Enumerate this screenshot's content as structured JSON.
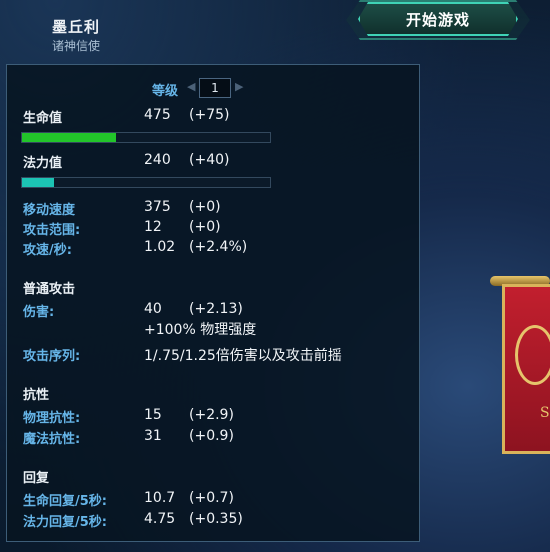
{
  "champion": {
    "name": "墨丘利",
    "title": "诸神信使"
  },
  "start_button": {
    "label": "开始游戏"
  },
  "level": {
    "label": "等级",
    "value": "1",
    "prev_icon": "triangle-left-icon",
    "next_icon": "triangle-right-icon"
  },
  "stats": {
    "health": {
      "label": "生命值",
      "value": "475",
      "bonus": "(+75)",
      "bar_fraction": 0.38,
      "bar_color": "#22c52a"
    },
    "mana": {
      "label": "法力值",
      "value": "240",
      "bonus": "(+40)",
      "bar_fraction": 0.13,
      "bar_color": "#1cc4b4"
    },
    "move_speed": {
      "label": "移动速度",
      "value": "375",
      "bonus": "(+0)"
    },
    "attack_range": {
      "label": "攻击范围:",
      "value": "12",
      "bonus": "(+0)"
    },
    "attack_speed": {
      "label": "攻速/秒:",
      "value": "1.02",
      "bonus": "(+2.4%)"
    }
  },
  "basic_attack": {
    "heading": "普通攻击",
    "damage": {
      "label": "伤害:",
      "value": "40",
      "bonus": "(+2.13)",
      "scaling": "+100% 物理强度"
    },
    "progression": {
      "label": "攻击序列:",
      "value": "1/.75/1.25倍伤害以及攻击前摇"
    }
  },
  "protections": {
    "heading": "抗性",
    "physical": {
      "label": "物理抗性:",
      "value": "15",
      "bonus": "(+2.9)"
    },
    "magical": {
      "label": "魔法抗性:",
      "value": "31",
      "bonus": "(+0.9)"
    }
  },
  "regen": {
    "heading": "回复",
    "hp5": {
      "label": "生命回复/5秒:",
      "value": "10.7",
      "bonus": "(+0.7)"
    },
    "mp5": {
      "label": "法力回复/5秒:",
      "value": "4.75",
      "bonus": "(+0.35)"
    }
  }
}
